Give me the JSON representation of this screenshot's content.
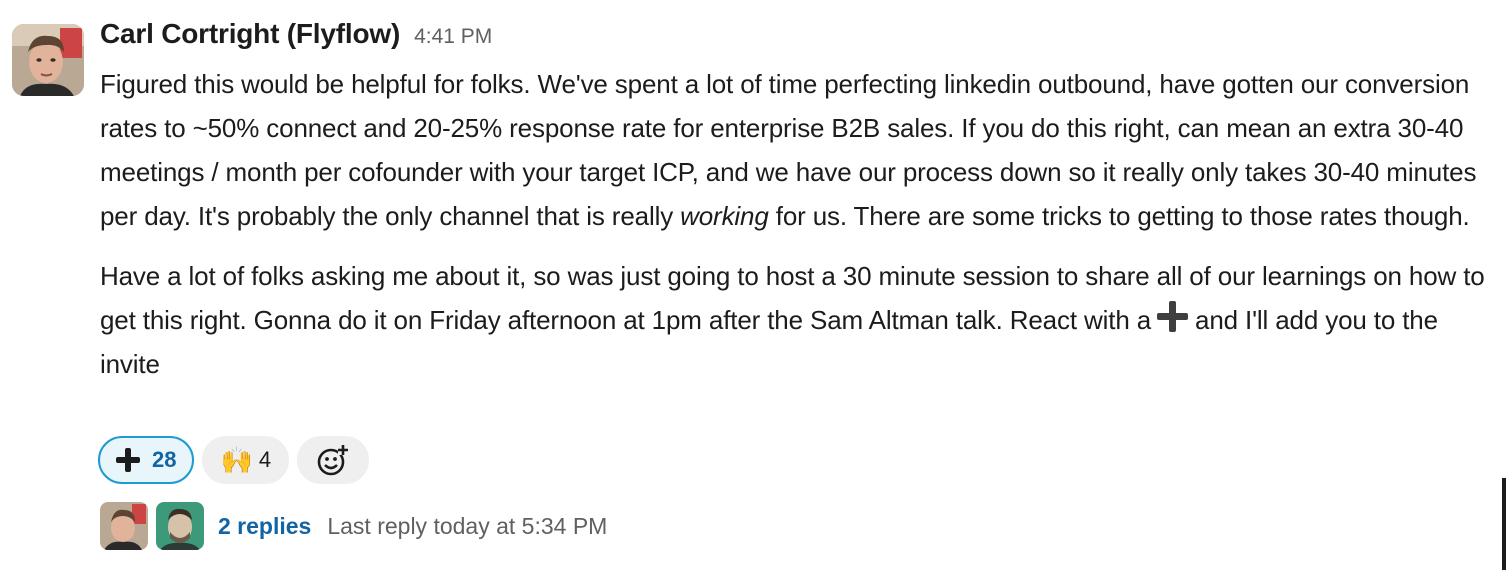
{
  "message": {
    "author": "Carl Cortright (Flyflow)",
    "timestamp": "4:41 PM",
    "paragraph1": {
      "text_before_italic": "Figured this would be helpful for folks. We've spent a lot of time perfecting linkedin outbound, have gotten our conversion rates to ~50% connect and 20-25% response rate for enterprise B2B sales. If you do this right, can mean an extra 30-40 meetings / month per cofounder with your target ICP, and we have our process down so it really only takes 30-40 minutes per day. It's probably the only channel that is really ",
      "italic": "working",
      "text_after_italic": " for us. There are some tricks to getting to those rates though."
    },
    "paragraph2": {
      "text_before_emoji": "Have a lot of folks asking me about it, so was just going to host a 30 minute session to share all of our learnings on how to get this right. Gonna do it on Friday afternoon at 1pm after the Sam Altman talk. React with a",
      "inline_emoji_icon": "heavy-plus-icon",
      "text_after_emoji": "and I'll add you to the invite"
    }
  },
  "reactions": [
    {
      "icon": "heavy-plus-icon",
      "count": "28",
      "active": true
    },
    {
      "emoji": "🙌",
      "icon": "raising-hands-icon",
      "count": "4",
      "active": false
    }
  ],
  "add_reaction_icon": "add-emoji-icon",
  "thread": {
    "replies_label": "2 replies",
    "last_reply": "Last reply today at 5:34 PM"
  },
  "colors": {
    "link": "#1264a3",
    "active_reaction_border": "#1d9bd1",
    "active_reaction_bg": "#e8f5fa",
    "muted_text": "#616061"
  }
}
